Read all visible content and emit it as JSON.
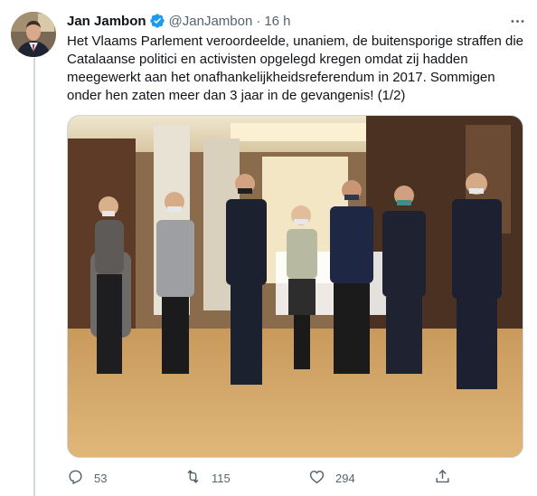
{
  "tweet": {
    "author_name": "Jan Jambon",
    "author_handle": "@JanJambon",
    "separator": "·",
    "timestamp": "16 h",
    "verified": true,
    "text": "Het Vlaams Parlement veroordeelde, unaniem, de buitensporige straffen die Catalaanse politici en activisten opgelegd kregen omdat zij hadden meegewerkt aan het onafhankelijkheidsreferendum in 2017. Sommigen onder hen zaten meer dan 3 jaar in de gevangenis! (1/2)"
  },
  "actions": {
    "reply_count": "53",
    "retweet_count": "115",
    "like_count": "294"
  },
  "icons": {
    "verified": "verified-badge-icon",
    "more": "more-options-icon",
    "reply": "reply-icon",
    "retweet": "retweet-icon",
    "like": "like-icon",
    "share": "share-icon"
  },
  "colors": {
    "accent": "#1d9bf0",
    "text_secondary": "#536471",
    "text_primary": "#0f1419"
  }
}
